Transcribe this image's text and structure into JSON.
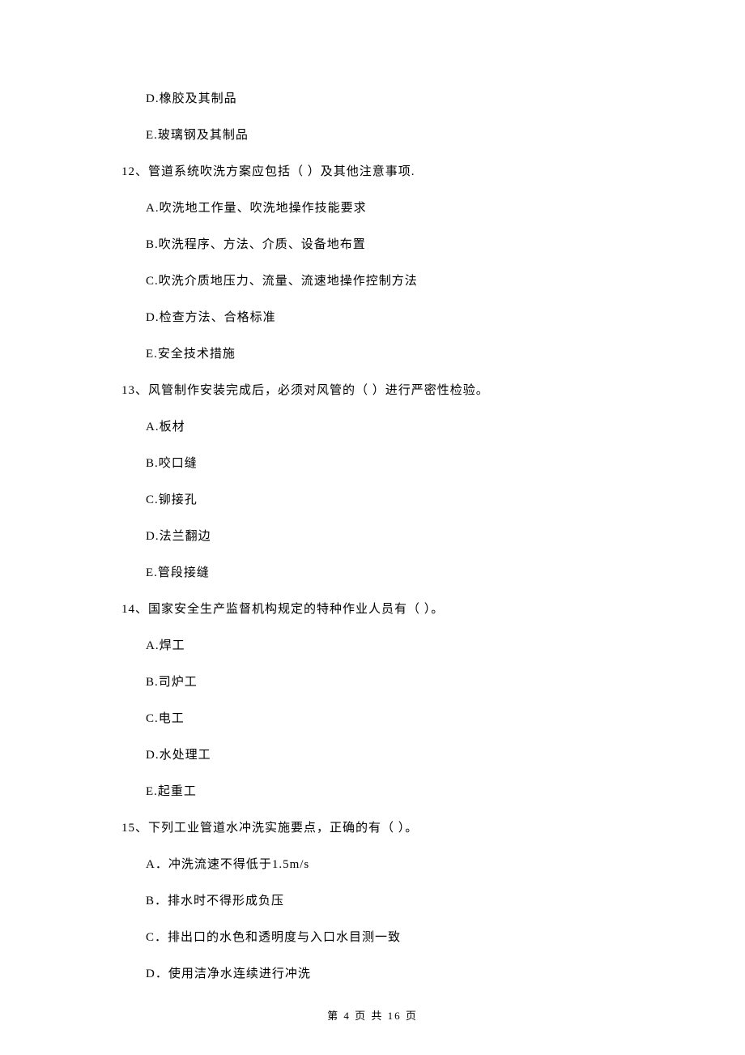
{
  "lines": {
    "d_prev": "D.橡胶及其制品",
    "e_prev": "E.玻璃钢及其制品",
    "q12": "12、管道系统吹洗方案应包括（    ）及其他注意事项.",
    "q12_a": "A.吹洗地工作量、吹洗地操作技能要求",
    "q12_b": "B.吹洗程序、方法、介质、设备地布置",
    "q12_c": "C.吹洗介质地压力、流量、流速地操作控制方法",
    "q12_d": "D.检查方法、合格标准",
    "q12_e": "E.安全技术措施",
    "q13": "13、风管制作安装完成后，必须对风管的（    ）进行严密性检验。",
    "q13_a": "A.板材",
    "q13_b": "B.咬口缝",
    "q13_c": "C.铆接孔",
    "q13_d": "D.法兰翻边",
    "q13_e": "E.管段接缝",
    "q14": "14、国家安全生产监督机构规定的特种作业人员有（    ）。",
    "q14_a": "A.焊工",
    "q14_b": "B.司炉工",
    "q14_c": "C.电工",
    "q14_d": "D.水处理工",
    "q14_e": "E.起重工",
    "q15": "15、下列工业管道水冲洗实施要点，正确的有（    ）。",
    "q15_a": "A．冲洗流速不得低于1.5m/s",
    "q15_b": "B．排水时不得形成负压",
    "q15_c": "C．排出口的水色和透明度与入口水目测一致",
    "q15_d": "D．使用洁净水连续进行冲洗"
  },
  "footer": "第 4 页 共 16 页"
}
